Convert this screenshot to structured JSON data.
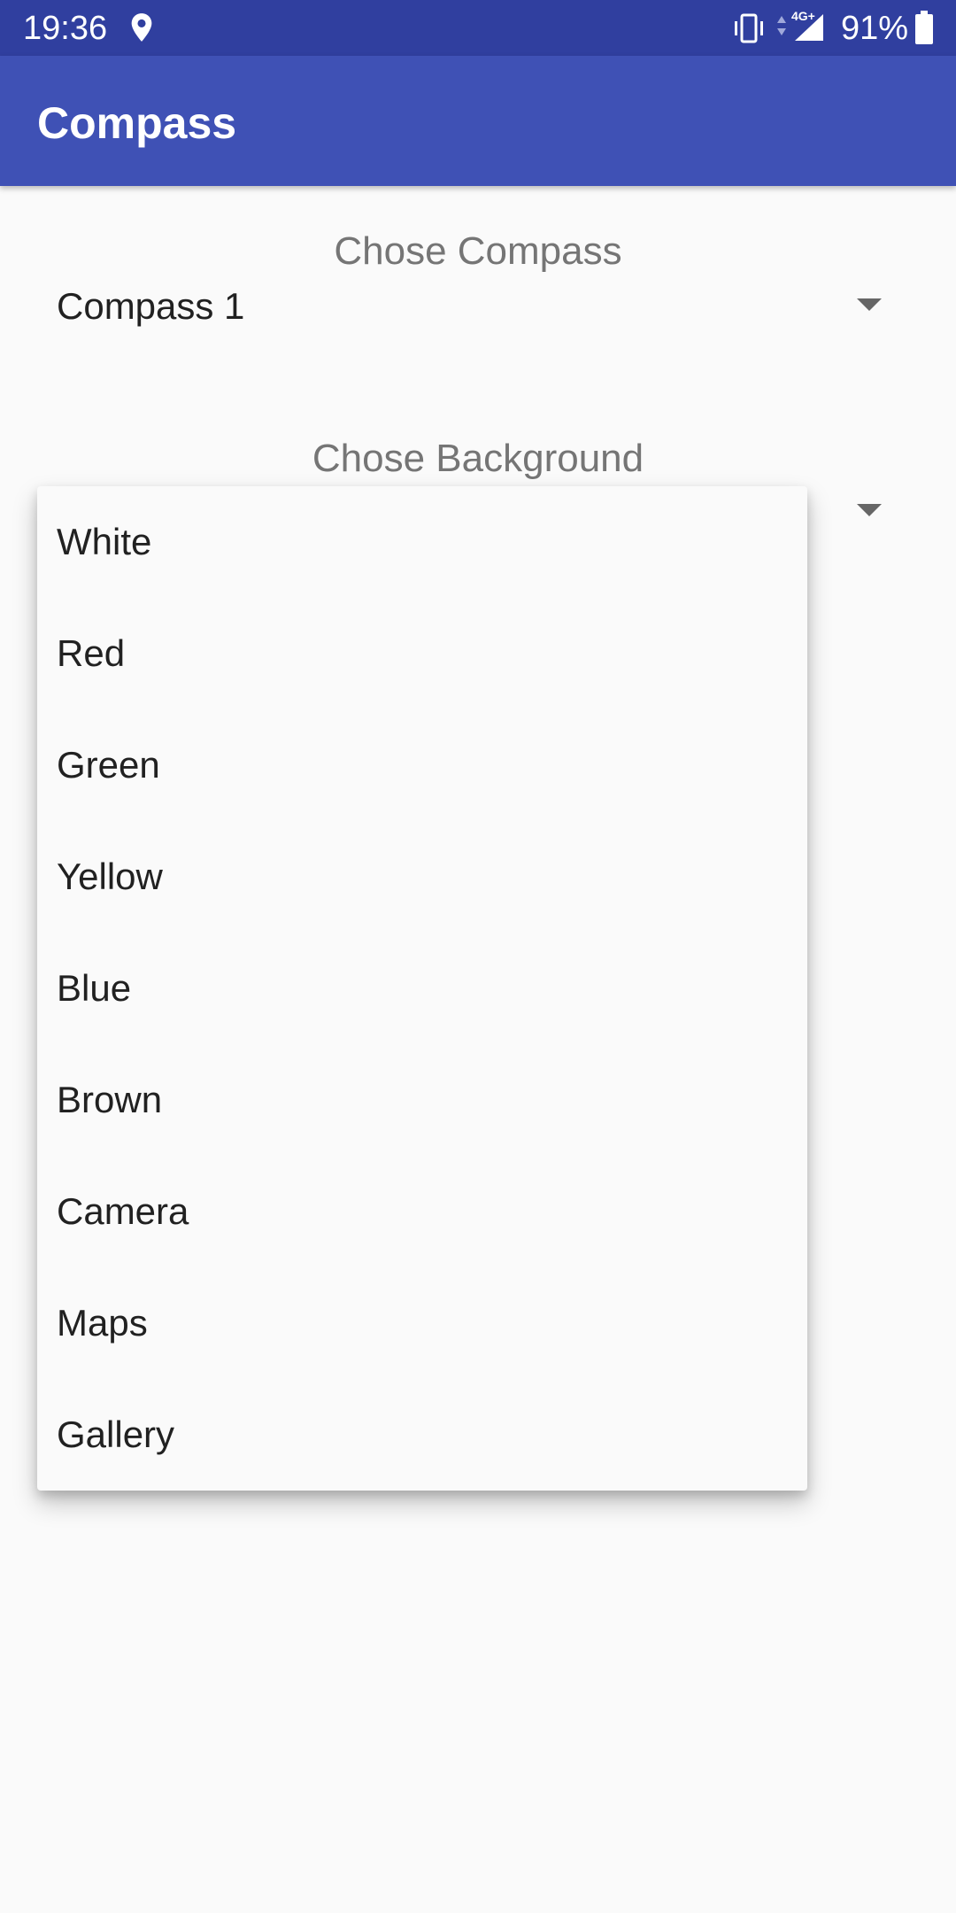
{
  "status_bar": {
    "time": "19:36",
    "network_type": "4G+",
    "battery_percent": "91%",
    "icons": [
      "location-icon",
      "vibrate-icon",
      "data-activity-icon",
      "signal-icon",
      "battery-icon"
    ]
  },
  "app_bar": {
    "title": "Compass"
  },
  "compass_section": {
    "label": "Chose Compass",
    "selected": "Compass 1"
  },
  "background_section": {
    "label": "Chose Background",
    "options": [
      {
        "label": "White"
      },
      {
        "label": "Red"
      },
      {
        "label": "Green"
      },
      {
        "label": "Yellow"
      },
      {
        "label": "Blue"
      },
      {
        "label": "Brown"
      },
      {
        "label": "Camera"
      },
      {
        "label": "Maps"
      },
      {
        "label": "Gallery"
      }
    ]
  },
  "colors": {
    "status_bar": "#303f9f",
    "app_bar": "#3f51b5",
    "background": "#fafafa",
    "label_text": "#757575",
    "primary_text": "#212121"
  }
}
